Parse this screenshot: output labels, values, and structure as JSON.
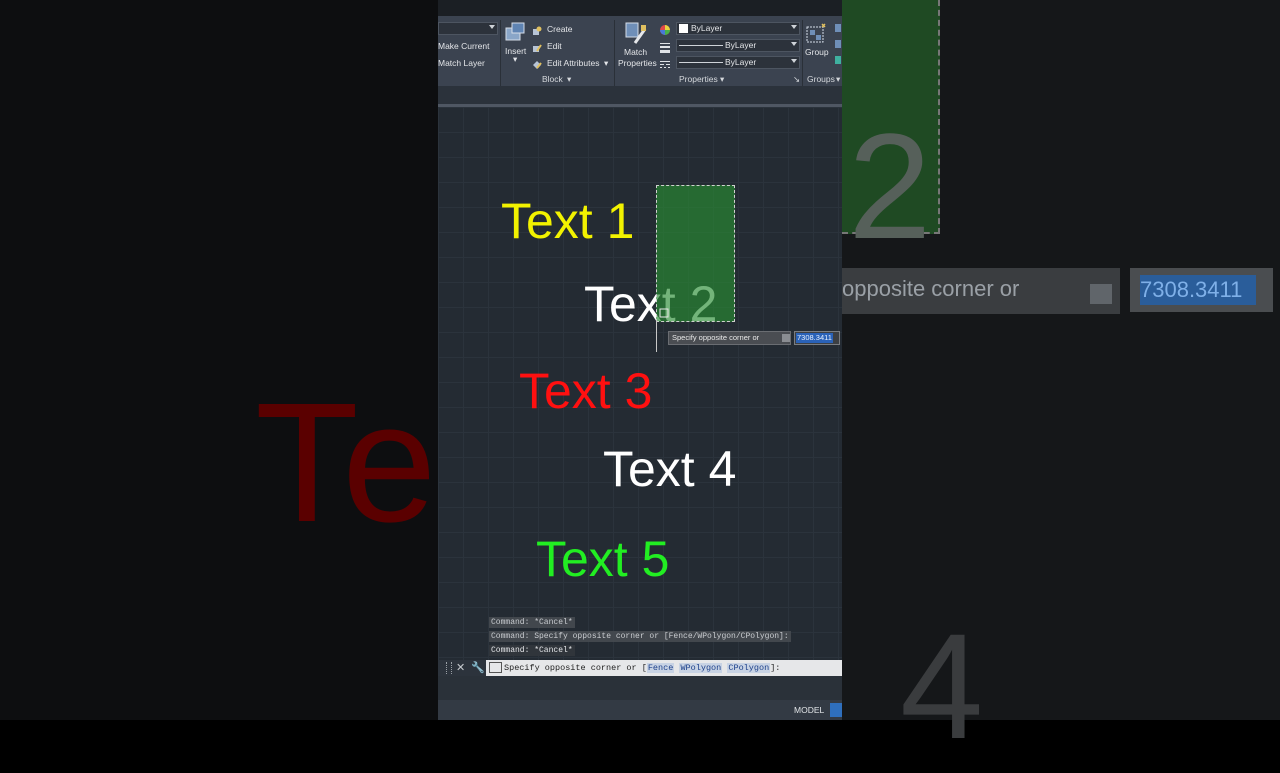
{
  "ribbon": {
    "make_current": "Make Current",
    "match_layer": "Match Layer",
    "insert": "Insert",
    "create": "Create",
    "edit": "Edit",
    "edit_attributes": "Edit Attributes",
    "block_panel": "Block",
    "match_properties_line1": "Match",
    "match_properties_line2": "Properties",
    "color_value": "ByLayer",
    "linetype_value": "ByLayer",
    "lineweight_value": "ByLayer",
    "properties_panel": "Properties",
    "group": "Group",
    "groups_panel": "Groups"
  },
  "canvas": {
    "labels": [
      {
        "text": "Text 1",
        "color": "#f2f200"
      },
      {
        "text": "Text 2",
        "color": "#ffffff"
      },
      {
        "text": "Text 3",
        "color": "#ff1010"
      },
      {
        "text": "Text 4",
        "color": "#ffffff"
      },
      {
        "text": "Text 5",
        "color": "#22ee22"
      }
    ],
    "tooltip_prompt": "Specify opposite corner or",
    "coordinate_value": "7308.3411"
  },
  "background": {
    "left_text": "Te",
    "right_digit_top": "2",
    "right_prompt": "opposite corner or",
    "right_value": "7308.3411",
    "right_digit_bottom": "4"
  },
  "command": {
    "history": [
      "Command: *Cancel*",
      "Command: Specify opposite corner or [Fence/WPolygon/CPolygon]:",
      "Command: *Cancel*"
    ],
    "prompt_prefix": "Specify opposite corner or [",
    "opt_fence": "Fence",
    "opt_wpolygon": "WPolygon",
    "opt_cpolygon": "CPolygon",
    "prompt_suffix": "]:"
  },
  "status": {
    "model_tab": "MODEL"
  }
}
